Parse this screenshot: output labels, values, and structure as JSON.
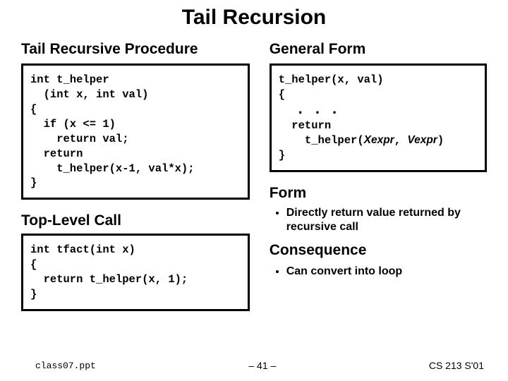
{
  "title": "Tail Recursion",
  "left": {
    "heading1": "Tail Recursive Procedure",
    "code1": "int t_helper\n  (int x, int val)\n{\n  if (x <= 1)\n    return val;\n  return\n    t_helper(x-1, val*x);\n}",
    "heading2": "Top-Level Call",
    "code2": "int tfact(int x)\n{\n  return t_helper(x, 1);\n}"
  },
  "right": {
    "heading1": "General Form",
    "gen": {
      "line1": "t_helper(x, val)",
      "line2": "{",
      "dots": ". . .",
      "line3": "  return",
      "line4_pre": "    t_helper(",
      "arg1": "Xexpr",
      "sep": ", ",
      "arg2": "Vexpr",
      "line4_post": ")",
      "line5": "}"
    },
    "heading2": "Form",
    "bullet1": "Directly return value returned by recursive call",
    "heading3": "Consequence",
    "bullet2": "Can convert into loop"
  },
  "footer": {
    "file": "class07.ppt",
    "page": "– 41 –",
    "course": "CS 213 S'01"
  }
}
